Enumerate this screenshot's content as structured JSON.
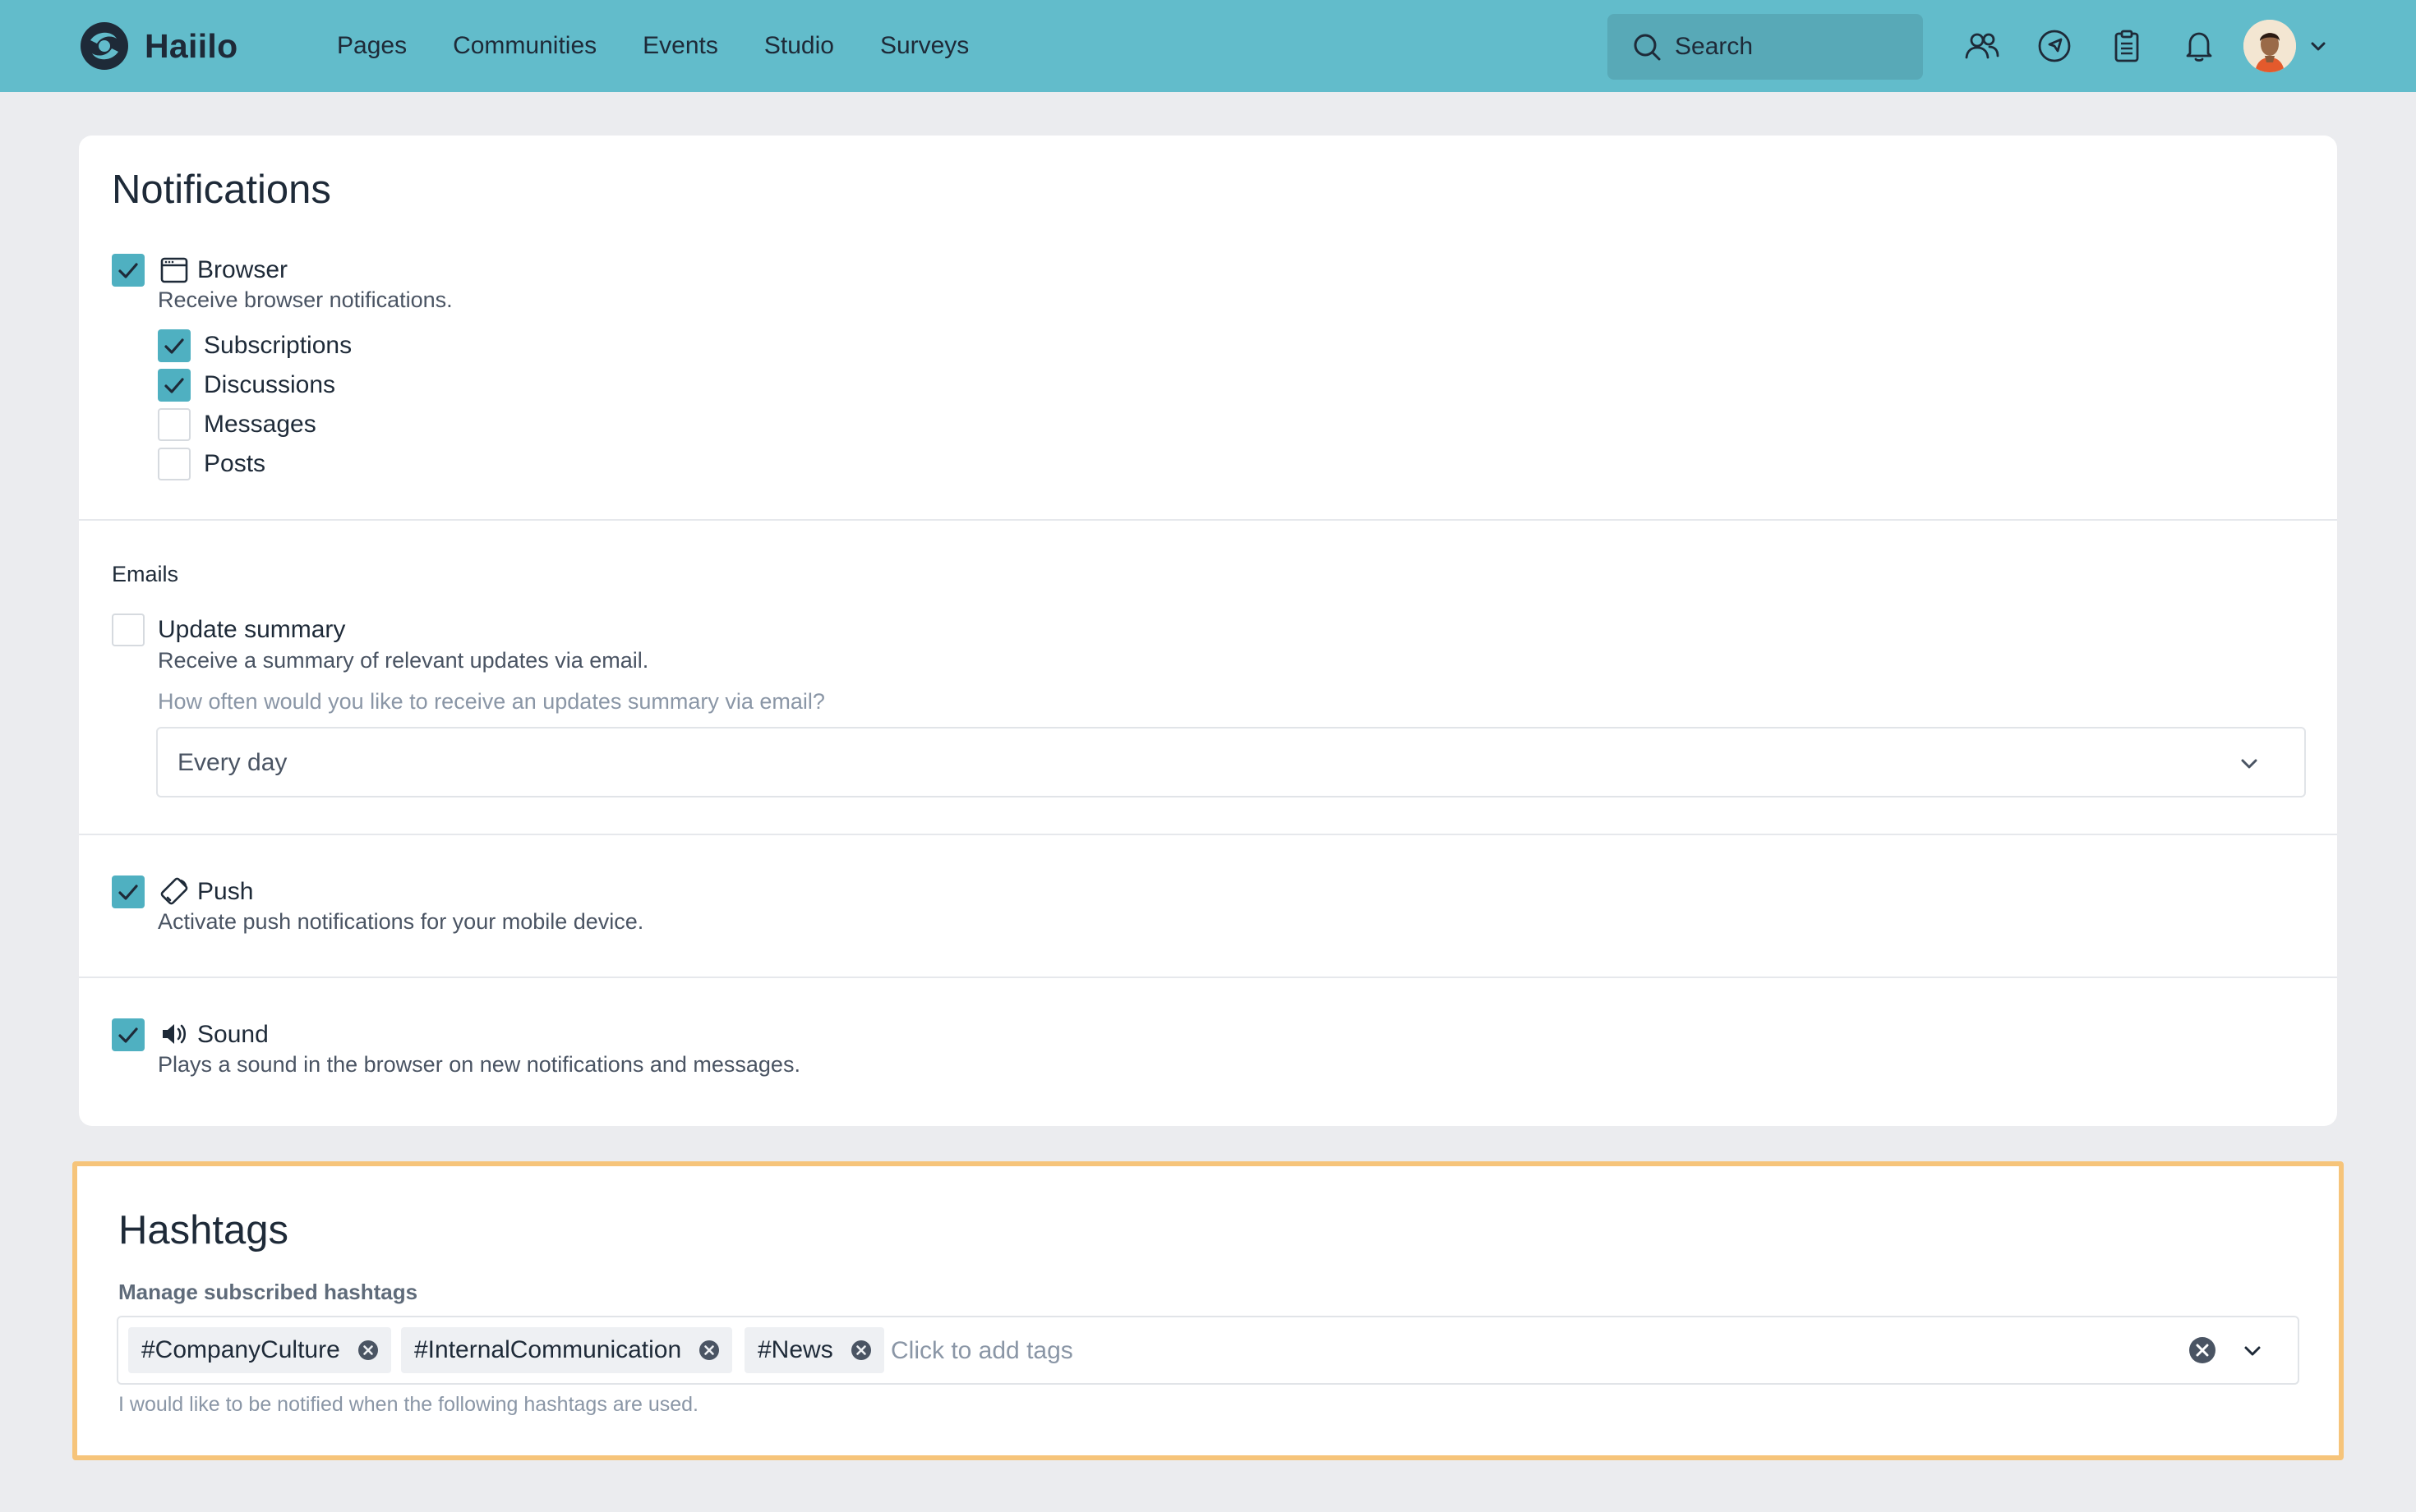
{
  "header": {
    "brand": "Haiilo",
    "nav": [
      "Pages",
      "Communities",
      "Events",
      "Studio",
      "Surveys"
    ],
    "search_label": "Search",
    "icons": [
      "colleagues-icon",
      "navigator-icon",
      "clipboard-icon",
      "bell-icon"
    ],
    "colors": {
      "bar": "#62bccb",
      "accent": "#4fb0c1"
    }
  },
  "notifications": {
    "title": "Notifications",
    "browser": {
      "label": "Browser",
      "checked": true,
      "icon": "browser-window-icon",
      "description": "Receive browser notifications.",
      "options": [
        {
          "label": "Subscriptions",
          "checked": true
        },
        {
          "label": "Discussions",
          "checked": true
        },
        {
          "label": "Messages",
          "checked": false
        },
        {
          "label": "Posts",
          "checked": false
        }
      ]
    },
    "emails": {
      "section_label": "Emails",
      "update_summary": {
        "label": "Update summary",
        "checked": false,
        "description": "Receive a summary of relevant updates via email.",
        "frequency_question": "How often would you like to receive an updates summary via email?",
        "frequency_value": "Every day"
      }
    },
    "push": {
      "label": "Push",
      "checked": true,
      "icon": "mobile-device-icon",
      "description": "Activate push notifications for your mobile device."
    },
    "sound": {
      "label": "Sound",
      "checked": true,
      "icon": "speaker-icon",
      "description": "Plays a sound in the browser on new notifications and messages."
    }
  },
  "hashtags": {
    "title": "Hashtags",
    "field_label": "Manage subscribed hashtags",
    "tags": [
      "#CompanyCulture",
      "#InternalCommunication",
      "#News"
    ],
    "placeholder": "Click to add tags",
    "hint": "I would like to be notified when the following hashtags are used.",
    "highlight_color": "#f6c47a"
  }
}
